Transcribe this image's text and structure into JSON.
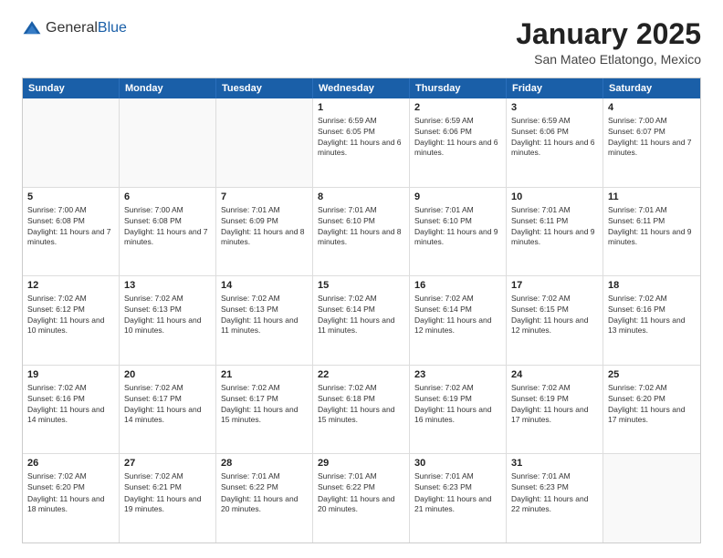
{
  "logo": {
    "general": "General",
    "blue": "Blue"
  },
  "header": {
    "month": "January 2025",
    "location": "San Mateo Etlatongo, Mexico"
  },
  "weekdays": [
    "Sunday",
    "Monday",
    "Tuesday",
    "Wednesday",
    "Thursday",
    "Friday",
    "Saturday"
  ],
  "rows": [
    [
      {
        "day": "",
        "sunrise": "",
        "sunset": "",
        "daylight": "",
        "empty": true
      },
      {
        "day": "",
        "sunrise": "",
        "sunset": "",
        "daylight": "",
        "empty": true
      },
      {
        "day": "",
        "sunrise": "",
        "sunset": "",
        "daylight": "",
        "empty": true
      },
      {
        "day": "1",
        "sunrise": "Sunrise: 6:59 AM",
        "sunset": "Sunset: 6:05 PM",
        "daylight": "Daylight: 11 hours and 6 minutes.",
        "empty": false
      },
      {
        "day": "2",
        "sunrise": "Sunrise: 6:59 AM",
        "sunset": "Sunset: 6:06 PM",
        "daylight": "Daylight: 11 hours and 6 minutes.",
        "empty": false
      },
      {
        "day": "3",
        "sunrise": "Sunrise: 6:59 AM",
        "sunset": "Sunset: 6:06 PM",
        "daylight": "Daylight: 11 hours and 6 minutes.",
        "empty": false
      },
      {
        "day": "4",
        "sunrise": "Sunrise: 7:00 AM",
        "sunset": "Sunset: 6:07 PM",
        "daylight": "Daylight: 11 hours and 7 minutes.",
        "empty": false
      }
    ],
    [
      {
        "day": "5",
        "sunrise": "Sunrise: 7:00 AM",
        "sunset": "Sunset: 6:08 PM",
        "daylight": "Daylight: 11 hours and 7 minutes.",
        "empty": false
      },
      {
        "day": "6",
        "sunrise": "Sunrise: 7:00 AM",
        "sunset": "Sunset: 6:08 PM",
        "daylight": "Daylight: 11 hours and 7 minutes.",
        "empty": false
      },
      {
        "day": "7",
        "sunrise": "Sunrise: 7:01 AM",
        "sunset": "Sunset: 6:09 PM",
        "daylight": "Daylight: 11 hours and 8 minutes.",
        "empty": false
      },
      {
        "day": "8",
        "sunrise": "Sunrise: 7:01 AM",
        "sunset": "Sunset: 6:10 PM",
        "daylight": "Daylight: 11 hours and 8 minutes.",
        "empty": false
      },
      {
        "day": "9",
        "sunrise": "Sunrise: 7:01 AM",
        "sunset": "Sunset: 6:10 PM",
        "daylight": "Daylight: 11 hours and 9 minutes.",
        "empty": false
      },
      {
        "day": "10",
        "sunrise": "Sunrise: 7:01 AM",
        "sunset": "Sunset: 6:11 PM",
        "daylight": "Daylight: 11 hours and 9 minutes.",
        "empty": false
      },
      {
        "day": "11",
        "sunrise": "Sunrise: 7:01 AM",
        "sunset": "Sunset: 6:11 PM",
        "daylight": "Daylight: 11 hours and 9 minutes.",
        "empty": false
      }
    ],
    [
      {
        "day": "12",
        "sunrise": "Sunrise: 7:02 AM",
        "sunset": "Sunset: 6:12 PM",
        "daylight": "Daylight: 11 hours and 10 minutes.",
        "empty": false
      },
      {
        "day": "13",
        "sunrise": "Sunrise: 7:02 AM",
        "sunset": "Sunset: 6:13 PM",
        "daylight": "Daylight: 11 hours and 10 minutes.",
        "empty": false
      },
      {
        "day": "14",
        "sunrise": "Sunrise: 7:02 AM",
        "sunset": "Sunset: 6:13 PM",
        "daylight": "Daylight: 11 hours and 11 minutes.",
        "empty": false
      },
      {
        "day": "15",
        "sunrise": "Sunrise: 7:02 AM",
        "sunset": "Sunset: 6:14 PM",
        "daylight": "Daylight: 11 hours and 11 minutes.",
        "empty": false
      },
      {
        "day": "16",
        "sunrise": "Sunrise: 7:02 AM",
        "sunset": "Sunset: 6:14 PM",
        "daylight": "Daylight: 11 hours and 12 minutes.",
        "empty": false
      },
      {
        "day": "17",
        "sunrise": "Sunrise: 7:02 AM",
        "sunset": "Sunset: 6:15 PM",
        "daylight": "Daylight: 11 hours and 12 minutes.",
        "empty": false
      },
      {
        "day": "18",
        "sunrise": "Sunrise: 7:02 AM",
        "sunset": "Sunset: 6:16 PM",
        "daylight": "Daylight: 11 hours and 13 minutes.",
        "empty": false
      }
    ],
    [
      {
        "day": "19",
        "sunrise": "Sunrise: 7:02 AM",
        "sunset": "Sunset: 6:16 PM",
        "daylight": "Daylight: 11 hours and 14 minutes.",
        "empty": false
      },
      {
        "day": "20",
        "sunrise": "Sunrise: 7:02 AM",
        "sunset": "Sunset: 6:17 PM",
        "daylight": "Daylight: 11 hours and 14 minutes.",
        "empty": false
      },
      {
        "day": "21",
        "sunrise": "Sunrise: 7:02 AM",
        "sunset": "Sunset: 6:17 PM",
        "daylight": "Daylight: 11 hours and 15 minutes.",
        "empty": false
      },
      {
        "day": "22",
        "sunrise": "Sunrise: 7:02 AM",
        "sunset": "Sunset: 6:18 PM",
        "daylight": "Daylight: 11 hours and 15 minutes.",
        "empty": false
      },
      {
        "day": "23",
        "sunrise": "Sunrise: 7:02 AM",
        "sunset": "Sunset: 6:19 PM",
        "daylight": "Daylight: 11 hours and 16 minutes.",
        "empty": false
      },
      {
        "day": "24",
        "sunrise": "Sunrise: 7:02 AM",
        "sunset": "Sunset: 6:19 PM",
        "daylight": "Daylight: 11 hours and 17 minutes.",
        "empty": false
      },
      {
        "day": "25",
        "sunrise": "Sunrise: 7:02 AM",
        "sunset": "Sunset: 6:20 PM",
        "daylight": "Daylight: 11 hours and 17 minutes.",
        "empty": false
      }
    ],
    [
      {
        "day": "26",
        "sunrise": "Sunrise: 7:02 AM",
        "sunset": "Sunset: 6:20 PM",
        "daylight": "Daylight: 11 hours and 18 minutes.",
        "empty": false
      },
      {
        "day": "27",
        "sunrise": "Sunrise: 7:02 AM",
        "sunset": "Sunset: 6:21 PM",
        "daylight": "Daylight: 11 hours and 19 minutes.",
        "empty": false
      },
      {
        "day": "28",
        "sunrise": "Sunrise: 7:01 AM",
        "sunset": "Sunset: 6:22 PM",
        "daylight": "Daylight: 11 hours and 20 minutes.",
        "empty": false
      },
      {
        "day": "29",
        "sunrise": "Sunrise: 7:01 AM",
        "sunset": "Sunset: 6:22 PM",
        "daylight": "Daylight: 11 hours and 20 minutes.",
        "empty": false
      },
      {
        "day": "30",
        "sunrise": "Sunrise: 7:01 AM",
        "sunset": "Sunset: 6:23 PM",
        "daylight": "Daylight: 11 hours and 21 minutes.",
        "empty": false
      },
      {
        "day": "31",
        "sunrise": "Sunrise: 7:01 AM",
        "sunset": "Sunset: 6:23 PM",
        "daylight": "Daylight: 11 hours and 22 minutes.",
        "empty": false
      },
      {
        "day": "",
        "sunrise": "",
        "sunset": "",
        "daylight": "",
        "empty": true
      }
    ]
  ]
}
